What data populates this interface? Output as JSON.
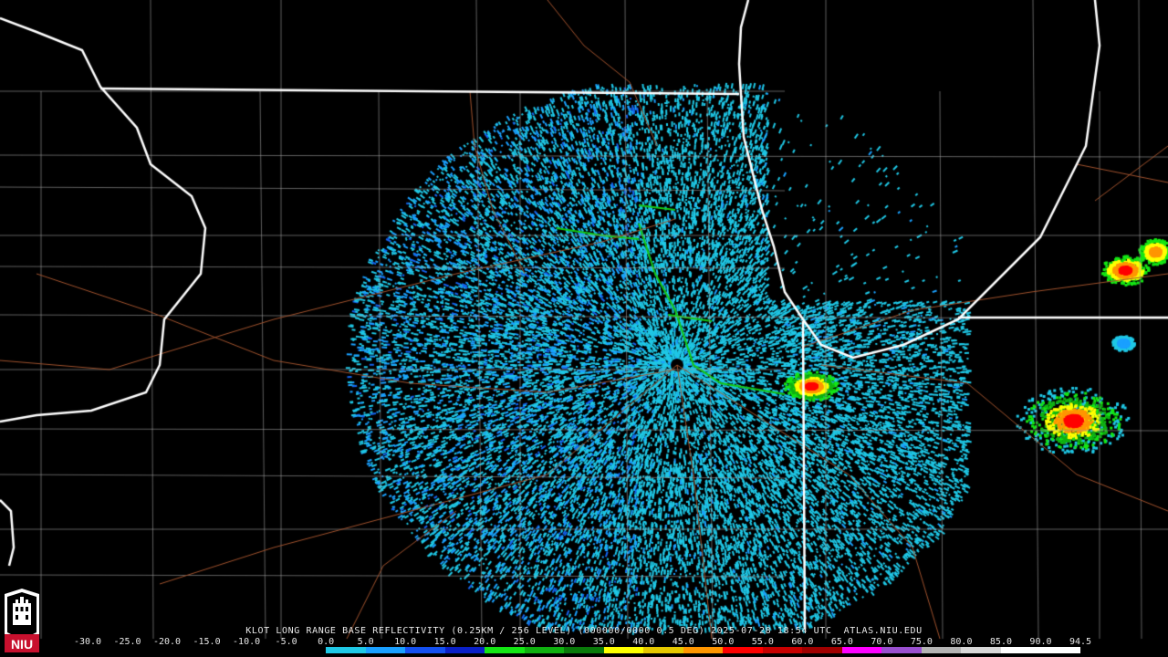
{
  "product": {
    "title": "KLOT LONG RANGE BASE REFLECTIVITY (0.25KM / 256 LEVEL) (000000/0000 0.5 DEG) 2025-07-28 18:54 UTC  ATLAS.NIU.EDU"
  },
  "legend": {
    "ticks": [
      "-30.0",
      "-25.0",
      "-20.0",
      "-15.0",
      "-10.0",
      "-5.0",
      "0.0",
      "5.0",
      "10.0",
      "15.0",
      "20.0",
      "25.0",
      "30.0",
      "35.0",
      "40.0",
      "45.0",
      "50.0",
      "55.0",
      "60.0",
      "65.0",
      "70.0",
      "75.0",
      "80.0",
      "85.0",
      "90.0",
      "94.5"
    ],
    "colors": [
      "#000000",
      "#000000",
      "#000000",
      "#000000",
      "#000000",
      "#000000",
      "#1fc8e6",
      "#1aa0ff",
      "#1450f0",
      "#0a20c8",
      "#14e614",
      "#10b010",
      "#0a7a0a",
      "#ffff00",
      "#e6c800",
      "#ff9600",
      "#ff0000",
      "#c80000",
      "#a00000",
      "#ff00ff",
      "#9a50d0",
      "#b4b4b4",
      "#d8d8d8",
      "#ffffff",
      "#ffffff"
    ]
  },
  "logo": {
    "text": "NIU",
    "color": "#c8102e"
  },
  "colors": {
    "state_border": "#ffffff",
    "county_line": "#a0a0a0",
    "highway": "#a0522d",
    "background": "#000000"
  }
}
